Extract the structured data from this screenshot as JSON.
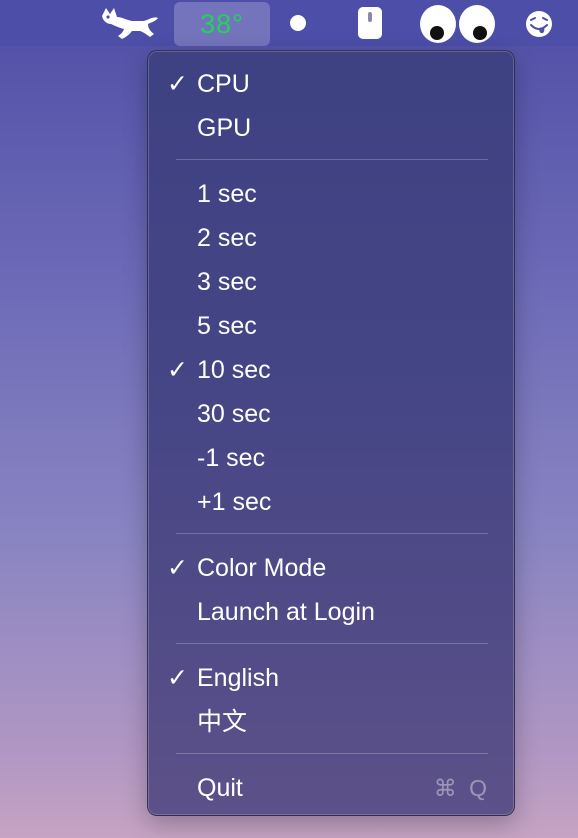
{
  "menubar": {
    "items": [
      {
        "icon": "running-cat-icon"
      },
      {
        "temperature": "38°",
        "color": "#22d35a"
      },
      {
        "icon": "white-dot-icon"
      },
      {
        "icon": "mouse-icon"
      },
      {
        "icon": "googly-eyes-icon"
      },
      {
        "icon": "tongue-out-face-icon"
      }
    ]
  },
  "menu": {
    "check_glyph": "✓",
    "sections": [
      [
        {
          "label": "CPU",
          "checked": true
        },
        {
          "label": "GPU",
          "checked": false
        }
      ],
      [
        {
          "label": "1 sec",
          "checked": false
        },
        {
          "label": "2 sec",
          "checked": false
        },
        {
          "label": "3 sec",
          "checked": false
        },
        {
          "label": "5 sec",
          "checked": false
        },
        {
          "label": "10 sec",
          "checked": true
        },
        {
          "label": "30 sec",
          "checked": false
        },
        {
          "label": "-1 sec",
          "checked": false
        },
        {
          "label": "+1 sec",
          "checked": false
        }
      ],
      [
        {
          "label": "Color Mode",
          "checked": true
        },
        {
          "label": "Launch at Login",
          "checked": false
        }
      ],
      [
        {
          "label": "English",
          "checked": true
        },
        {
          "label": "中文",
          "checked": false
        }
      ],
      [
        {
          "label": "Quit",
          "checked": false,
          "shortcut": "⌘ Q"
        }
      ]
    ]
  }
}
